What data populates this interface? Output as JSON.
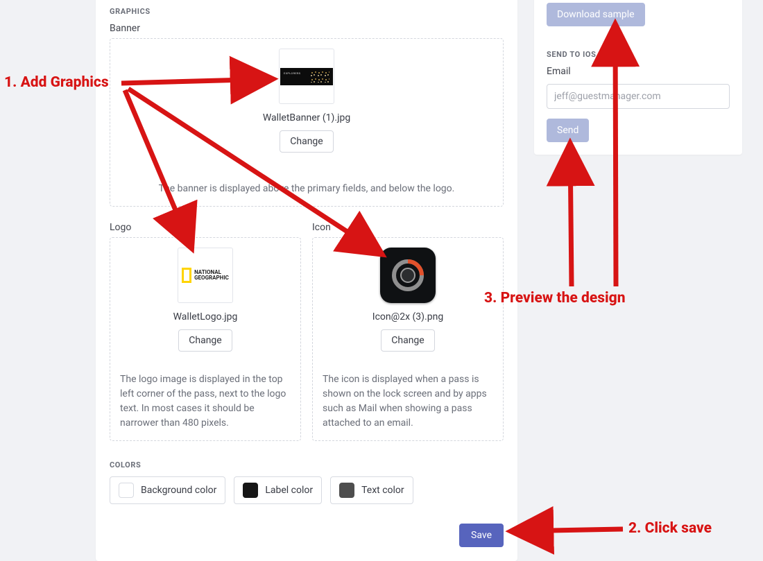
{
  "graphics": {
    "heading": "GRAPHICS",
    "banner": {
      "label": "Banner",
      "filename": "WalletBanner (1).jpg",
      "change": "Change",
      "hint": "The banner is displayed above the primary fields, and below the logo."
    },
    "logo": {
      "label": "Logo",
      "brand_line1": "NATIONAL",
      "brand_line2": "GEOGRAPHIC",
      "filename": "WalletLogo.jpg",
      "change": "Change",
      "hint": "The logo image is displayed in the top left corner of the pass, next to the logo text. In most cases it should be narrower than 480 pixels."
    },
    "icon": {
      "label": "Icon",
      "filename": "Icon@2x (3).png",
      "change": "Change",
      "hint": "The icon is displayed when a pass is shown on the lock screen and by apps such as Mail when showing a pass attached to an email."
    }
  },
  "colors": {
    "heading": "COLORS",
    "background": "Background color",
    "label": "Label color",
    "text": "Text color"
  },
  "save_label": "Save",
  "side": {
    "download_sample": "Download sample",
    "send_heading": "SEND TO IOS DEVICE",
    "email_label": "Email",
    "email_placeholder": "jeff@guestmanager.com",
    "send": "Send"
  },
  "annotations": {
    "step1": "1. Add Graphics",
    "step2": "2. Click save",
    "step3": "3. Preview the design"
  }
}
